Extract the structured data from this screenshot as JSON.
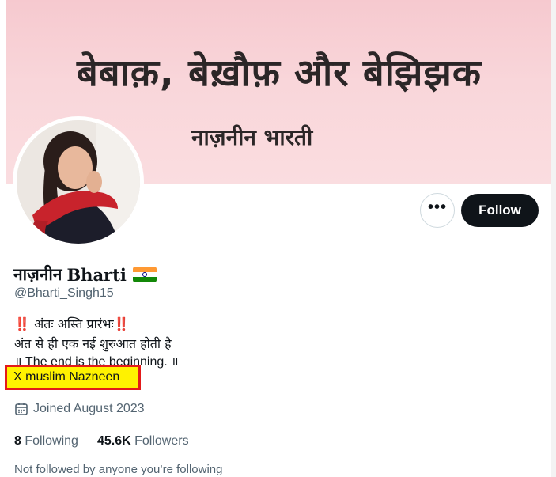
{
  "banner": {
    "title": "बेबाक़, बेख़ौफ़ और बेझिझक",
    "subtitle": "नाज़नीन भारती"
  },
  "profile": {
    "name_hindi": "नाज़नीन",
    "name_latin": "Bharti",
    "handle": "@Bharti_Singh15",
    "bio": {
      "line1_prefix": "‼️",
      "line1_text": " अंतः अस्ति प्रारंभः",
      "line1_suffix": "‼️",
      "line2": "अंत से ही एक नई शुरुआत होती है",
      "line3": "॥ The end is the beginning. ॥"
    },
    "highlighted_text": "X muslim Nazneen",
    "joined": "Joined August 2023",
    "following_count": "8",
    "following_label": "Following",
    "followers_count": "45.6K",
    "followers_label": "Followers",
    "followed_by": "Not followed by anyone you’re following"
  },
  "actions": {
    "more_label": "•••",
    "follow_label": "Follow"
  },
  "icons": {
    "more": "more-horizontal-icon",
    "calendar": "calendar-icon",
    "flag": "india-flag-icon"
  },
  "colors": {
    "follow_bg": "#0f1419",
    "highlight_bg": "#fff200",
    "highlight_border": "#e31a1a",
    "banner_bg": "#f6c9cf"
  }
}
